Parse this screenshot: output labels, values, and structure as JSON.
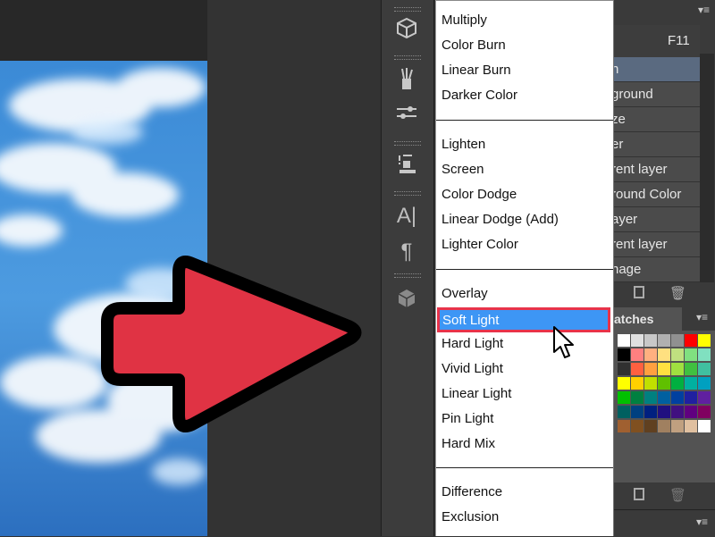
{
  "blend_menu": {
    "groups": [
      [
        "Multiply",
        "Color Burn",
        "Linear Burn",
        "Darker Color"
      ],
      [
        "Lighten",
        "Screen",
        "Color Dodge",
        "Linear Dodge (Add)",
        "Lighter Color"
      ],
      [
        "Overlay",
        "Soft Light",
        "Hard Light",
        "Vivid Light",
        "Linear Light",
        "Pin Light",
        "Hard Mix"
      ],
      [
        "Difference",
        "Exclusion"
      ]
    ],
    "highlighted": "Soft Light"
  },
  "panel": {
    "shortcut": "F11",
    "rows": [
      "n",
      "ground",
      "ze",
      "er",
      "rent layer",
      "round Color",
      "ayer",
      "rent layer",
      "nage"
    ],
    "swatches_tab": "atches"
  },
  "toolbar_icons": [
    "cube-icon",
    "brush-icon",
    "adjust-icon",
    "stamp-icon",
    "type-icon",
    "paragraph-icon",
    "3d-icon"
  ],
  "colors": {
    "highlight": "#3d96f5",
    "highlight_border": "#e8334a",
    "arrow_fill": "#e03344"
  }
}
